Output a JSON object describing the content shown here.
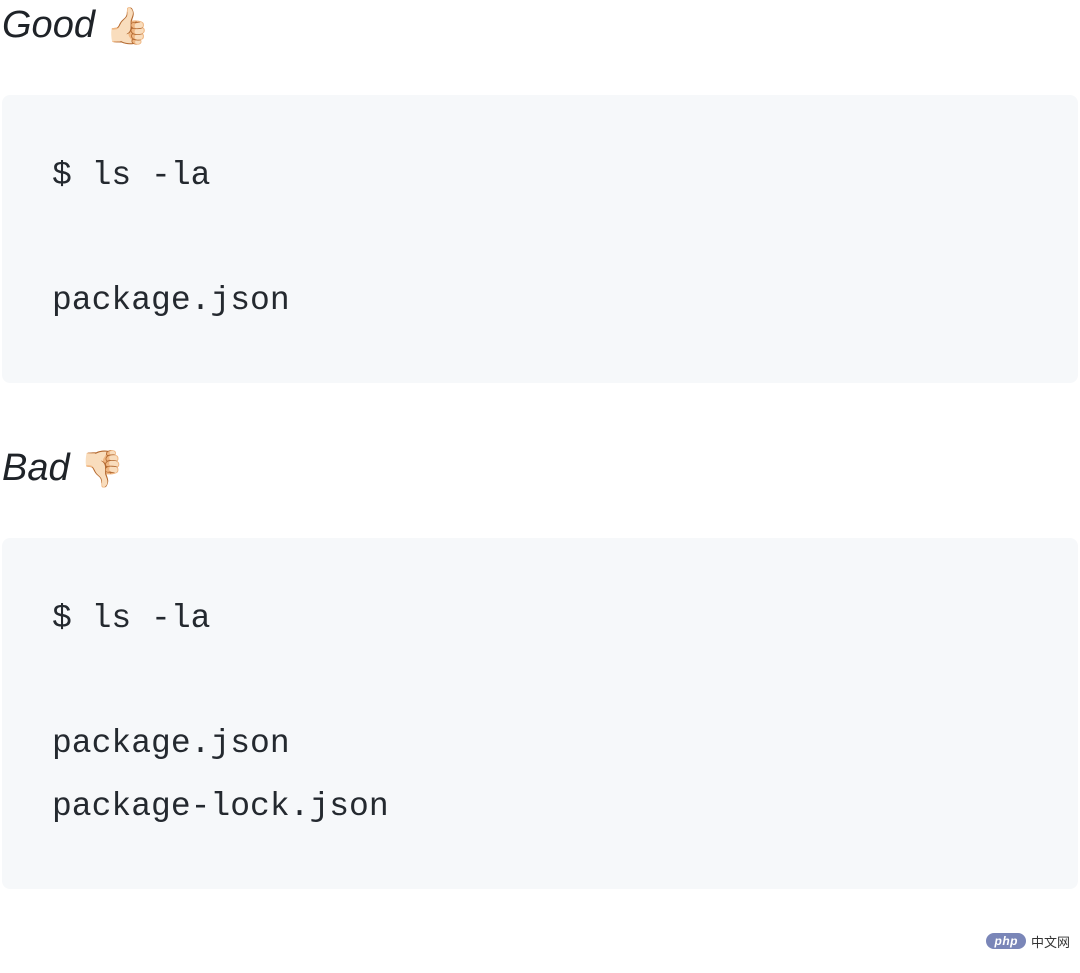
{
  "sections": {
    "good": {
      "label": "Good",
      "emoji": "👍🏻",
      "code": "$ ls -la\n\npackage.json"
    },
    "bad": {
      "label": "Bad",
      "emoji": "👎🏻",
      "code": "$ ls -la\n\npackage.json\npackage-lock.json"
    }
  },
  "watermark": {
    "badge": "php",
    "text": "中文网"
  }
}
